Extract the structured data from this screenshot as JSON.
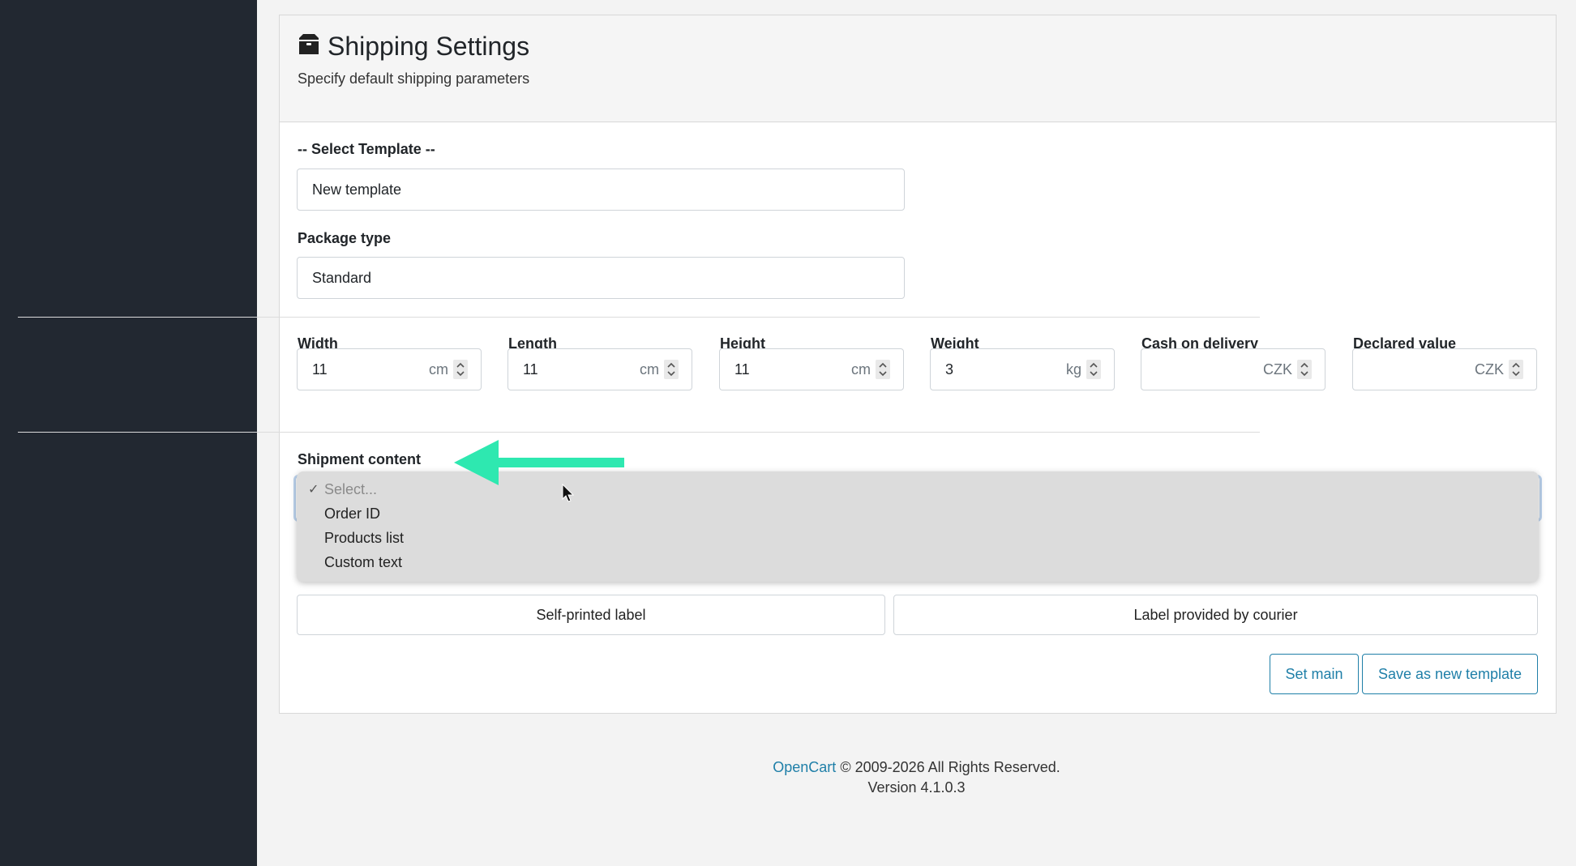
{
  "header": {
    "title": "Shipping Settings",
    "subtitle": "Specify default shipping parameters",
    "icon": "box-icon"
  },
  "template": {
    "label": "-- Select Template --",
    "value": "New template"
  },
  "package_type": {
    "label": "Package type",
    "value": "Standard"
  },
  "dimensions": [
    {
      "label": "Width",
      "value": "11",
      "unit": "cm"
    },
    {
      "label": "Length",
      "value": "11",
      "unit": "cm"
    },
    {
      "label": "Height",
      "value": "11",
      "unit": "cm"
    },
    {
      "label": "Weight",
      "value": "3",
      "unit": "kg"
    },
    {
      "label": "Cash on delivery",
      "value": "",
      "unit": "CZK"
    },
    {
      "label": "Declared value",
      "value": "",
      "unit": "CZK"
    }
  ],
  "shipment_content": {
    "label": "Shipment content",
    "options": [
      "Select...",
      "Order ID",
      "Products list",
      "Custom text"
    ],
    "selected": "Select..."
  },
  "label_type": {
    "self_printed": "Self-printed label",
    "courier": "Label provided by courier"
  },
  "actions": {
    "set_main": "Set main",
    "save_new": "Save as new template"
  },
  "footer": {
    "brand": "OpenCart",
    "copyright": "© 2009-2026 All Rights Reserved.",
    "version": "Version 4.1.0.3"
  },
  "colors": {
    "sidebar": "#222831",
    "accent": "#1f7fa8",
    "arrow": "#2ee8b0"
  }
}
